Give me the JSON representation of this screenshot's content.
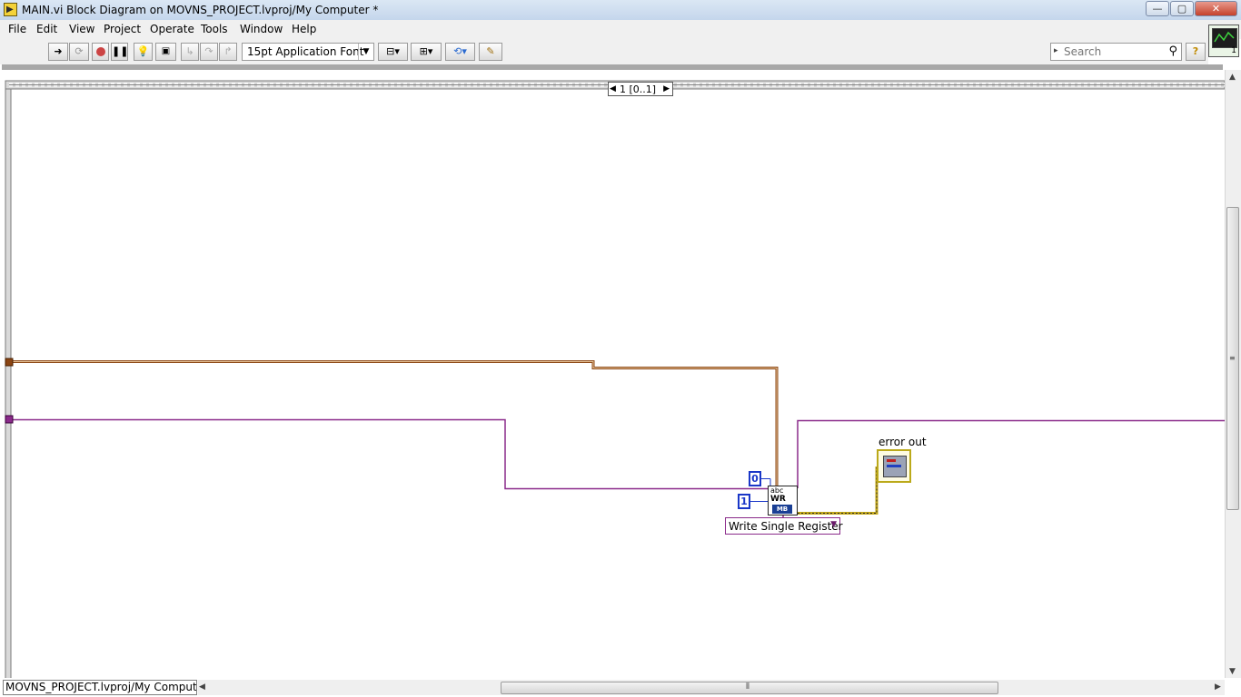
{
  "window": {
    "title": "MAIN.vi Block Diagram on MOVNS_PROJECT.lvproj/My Computer *",
    "minimize_glyph": "—",
    "maximize_glyph": "▢",
    "close_glyph": "✕"
  },
  "menu": {
    "items": [
      "File",
      "Edit",
      "View",
      "Project",
      "Operate",
      "Tools",
      "Window",
      "Help"
    ]
  },
  "toolbar": {
    "font_select": "15pt Application Font",
    "search_placeholder": "Search",
    "help_label": "?"
  },
  "vi_icon": {
    "connector_number": "1"
  },
  "diagram": {
    "case_selector": {
      "label": "1 [0..1]",
      "prev_glyph": "◀",
      "next_glyph": "▶"
    },
    "constants": {
      "zero": "0",
      "one": "1"
    },
    "modbus_node": {
      "abc": "abc",
      "wr": "WR",
      "mb": "MB"
    },
    "ring_constant": {
      "label": "Write Single Register"
    },
    "error_indicator": {
      "label": "error out"
    }
  },
  "statusbar": {
    "context": "MOVNS_PROJECT.lvproj/My Computer"
  },
  "colors": {
    "wire_orange": "#8b4513",
    "wire_purple": "#8a2a8a",
    "wire_error": "#c5a91a",
    "constant_blue": "#1a37c8"
  }
}
